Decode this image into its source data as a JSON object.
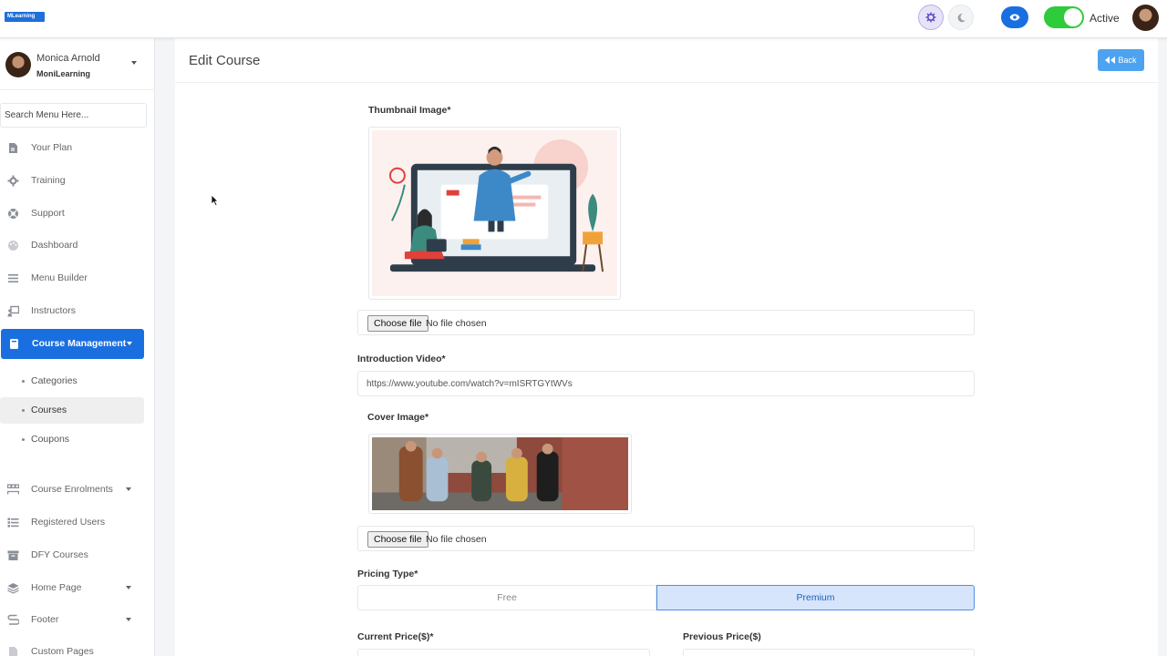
{
  "topbar": {
    "logo_text": "MLearning",
    "status_label": "Active",
    "status_on": true,
    "colors": {
      "brand": "#1a6fe0",
      "toggle_on": "#2ecb3a"
    }
  },
  "sidebar": {
    "user": {
      "name": "Monica Arnold",
      "org": "MoniLearning"
    },
    "search_placeholder": "Search Menu Here...",
    "items": [
      {
        "label": "Your Plan",
        "icon": "plan-icon"
      },
      {
        "label": "Training",
        "icon": "gear-icon"
      },
      {
        "label": "Support",
        "icon": "lifebuoy-icon"
      },
      {
        "label": "Dashboard",
        "icon": "palette-icon"
      },
      {
        "label": "Menu Builder",
        "icon": "menu-icon"
      },
      {
        "label": "Instructors",
        "icon": "instructor-icon"
      },
      {
        "label": "Course Management",
        "icon": "book-icon",
        "active": true
      }
    ],
    "sub_items": [
      {
        "label": "Categories"
      },
      {
        "label": "Courses",
        "selected": true
      },
      {
        "label": "Coupons"
      }
    ],
    "items_lower": [
      {
        "label": "Course Enrolments",
        "icon": "users-icon",
        "has_caret": true
      },
      {
        "label": "Registered Users",
        "icon": "list-icon"
      },
      {
        "label": "DFY Courses",
        "icon": "archive-icon"
      },
      {
        "label": "Home Page",
        "icon": "layers-icon",
        "has_caret": true
      },
      {
        "label": "Footer",
        "icon": "footer-icon",
        "has_caret": true
      },
      {
        "label": "Custom Pages",
        "icon": "page-icon"
      }
    ]
  },
  "main": {
    "title": "Edit Course",
    "back_label": "Back",
    "thumbnail": {
      "label": "Thumbnail Image*",
      "file_button": "Choose file",
      "file_status": "No file chosen"
    },
    "intro_video": {
      "label": "Introduction Video*",
      "value": "https://www.youtube.com/watch?v=mISRTGYtWVs"
    },
    "cover": {
      "label": "Cover Image*",
      "file_button": "Choose file",
      "file_status": "No file chosen"
    },
    "pricing": {
      "label": "Pricing Type*",
      "options": [
        "Free",
        "Premium"
      ],
      "selected": "Premium"
    },
    "current_price": {
      "label": "Current Price($)*"
    },
    "previous_price": {
      "label": "Previous Price($)"
    }
  }
}
